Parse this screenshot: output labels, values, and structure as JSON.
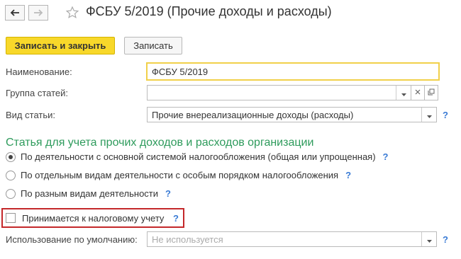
{
  "window": {
    "title": "ФСБУ 5/2019 (Прочие доходы и расходы)"
  },
  "toolbar": {
    "save_close_label": "Записать и закрыть",
    "save_label": "Записать"
  },
  "form": {
    "name": {
      "label": "Наименование:",
      "value": "ФСБУ 5/2019"
    },
    "group": {
      "label": "Группа статей:",
      "value": ""
    },
    "type": {
      "label": "Вид статьи:",
      "value": "Прочие внереализационные доходы (расходы)"
    }
  },
  "section": {
    "title": "Статья для учета прочих доходов и расходов организации",
    "options": [
      {
        "label": "По деятельности с основной системой налогообложения (общая или упрощенная)",
        "checked": true
      },
      {
        "label": "По отдельным видам деятельности с особым порядком налогообложения",
        "checked": false
      },
      {
        "label": "По разным видам деятельности",
        "checked": false
      }
    ]
  },
  "tax": {
    "checkbox_label": "Принимается к налоговому учету",
    "checked": false
  },
  "default_usage": {
    "label": "Использование по умолчанию:",
    "placeholder": "Не используется"
  },
  "help_mark": "?",
  "colors": {
    "primary_button": "#f8d82a",
    "section_title": "#2e9b5c",
    "help": "#3a7bd5",
    "highlight_border": "#c4282a",
    "active_field_border": "#f1d04a"
  },
  "icons": [
    "back-arrow-icon",
    "forward-arrow-icon",
    "star-icon",
    "dropdown-arrow-icon",
    "clear-icon",
    "open-icon",
    "help-icon"
  ]
}
